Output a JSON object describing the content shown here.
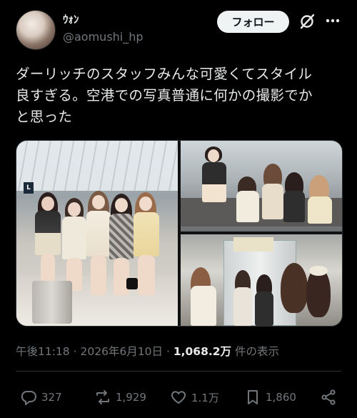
{
  "user": {
    "name": "ｳｫﾝ",
    "handle": "@aomushi_hp"
  },
  "header": {
    "follow_label": "フォロー"
  },
  "tweet": {
    "text_lines": [
      "ダーリッチのスタッフみんな可愛くてスタイル",
      "良すぎる。空港での写真普通に何かの撮影でか",
      "と思った"
    ]
  },
  "media": {
    "count": 3,
    "sign_letter": "L"
  },
  "meta": {
    "time": "午後11:18",
    "separator": "·",
    "date": "2026年6月10日",
    "separator2": "·",
    "views_count": "1,068.2万",
    "views_label": "件の表示"
  },
  "actions": {
    "replies": "327",
    "reposts": "1,929",
    "likes": "1.1万",
    "bookmarks": "1,860"
  },
  "icons": [
    "grok-icon",
    "more-icon",
    "reply-icon",
    "repost-icon",
    "like-icon",
    "bookmark-icon",
    "share-icon"
  ],
  "colors": {
    "background": "#000000",
    "text": "#e7e9ea",
    "muted": "#71767b",
    "button_bg": "#eff3f4",
    "divider": "#2f3336"
  }
}
